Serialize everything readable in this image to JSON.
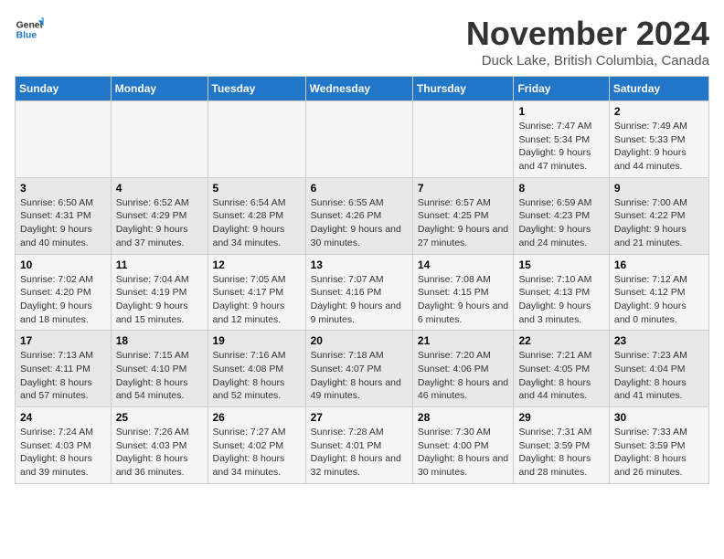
{
  "logo": {
    "line1": "General",
    "line2": "Blue"
  },
  "title": "November 2024",
  "subtitle": "Duck Lake, British Columbia, Canada",
  "days_of_week": [
    "Sunday",
    "Monday",
    "Tuesday",
    "Wednesday",
    "Thursday",
    "Friday",
    "Saturday"
  ],
  "weeks": [
    [
      {
        "day": "",
        "info": ""
      },
      {
        "day": "",
        "info": ""
      },
      {
        "day": "",
        "info": ""
      },
      {
        "day": "",
        "info": ""
      },
      {
        "day": "",
        "info": ""
      },
      {
        "day": "1",
        "info": "Sunrise: 7:47 AM\nSunset: 5:34 PM\nDaylight: 9 hours and 47 minutes."
      },
      {
        "day": "2",
        "info": "Sunrise: 7:49 AM\nSunset: 5:33 PM\nDaylight: 9 hours and 44 minutes."
      }
    ],
    [
      {
        "day": "3",
        "info": "Sunrise: 6:50 AM\nSunset: 4:31 PM\nDaylight: 9 hours and 40 minutes."
      },
      {
        "day": "4",
        "info": "Sunrise: 6:52 AM\nSunset: 4:29 PM\nDaylight: 9 hours and 37 minutes."
      },
      {
        "day": "5",
        "info": "Sunrise: 6:54 AM\nSunset: 4:28 PM\nDaylight: 9 hours and 34 minutes."
      },
      {
        "day": "6",
        "info": "Sunrise: 6:55 AM\nSunset: 4:26 PM\nDaylight: 9 hours and 30 minutes."
      },
      {
        "day": "7",
        "info": "Sunrise: 6:57 AM\nSunset: 4:25 PM\nDaylight: 9 hours and 27 minutes."
      },
      {
        "day": "8",
        "info": "Sunrise: 6:59 AM\nSunset: 4:23 PM\nDaylight: 9 hours and 24 minutes."
      },
      {
        "day": "9",
        "info": "Sunrise: 7:00 AM\nSunset: 4:22 PM\nDaylight: 9 hours and 21 minutes."
      }
    ],
    [
      {
        "day": "10",
        "info": "Sunrise: 7:02 AM\nSunset: 4:20 PM\nDaylight: 9 hours and 18 minutes."
      },
      {
        "day": "11",
        "info": "Sunrise: 7:04 AM\nSunset: 4:19 PM\nDaylight: 9 hours and 15 minutes."
      },
      {
        "day": "12",
        "info": "Sunrise: 7:05 AM\nSunset: 4:17 PM\nDaylight: 9 hours and 12 minutes."
      },
      {
        "day": "13",
        "info": "Sunrise: 7:07 AM\nSunset: 4:16 PM\nDaylight: 9 hours and 9 minutes."
      },
      {
        "day": "14",
        "info": "Sunrise: 7:08 AM\nSunset: 4:15 PM\nDaylight: 9 hours and 6 minutes."
      },
      {
        "day": "15",
        "info": "Sunrise: 7:10 AM\nSunset: 4:13 PM\nDaylight: 9 hours and 3 minutes."
      },
      {
        "day": "16",
        "info": "Sunrise: 7:12 AM\nSunset: 4:12 PM\nDaylight: 9 hours and 0 minutes."
      }
    ],
    [
      {
        "day": "17",
        "info": "Sunrise: 7:13 AM\nSunset: 4:11 PM\nDaylight: 8 hours and 57 minutes."
      },
      {
        "day": "18",
        "info": "Sunrise: 7:15 AM\nSunset: 4:10 PM\nDaylight: 8 hours and 54 minutes."
      },
      {
        "day": "19",
        "info": "Sunrise: 7:16 AM\nSunset: 4:08 PM\nDaylight: 8 hours and 52 minutes."
      },
      {
        "day": "20",
        "info": "Sunrise: 7:18 AM\nSunset: 4:07 PM\nDaylight: 8 hours and 49 minutes."
      },
      {
        "day": "21",
        "info": "Sunrise: 7:20 AM\nSunset: 4:06 PM\nDaylight: 8 hours and 46 minutes."
      },
      {
        "day": "22",
        "info": "Sunrise: 7:21 AM\nSunset: 4:05 PM\nDaylight: 8 hours and 44 minutes."
      },
      {
        "day": "23",
        "info": "Sunrise: 7:23 AM\nSunset: 4:04 PM\nDaylight: 8 hours and 41 minutes."
      }
    ],
    [
      {
        "day": "24",
        "info": "Sunrise: 7:24 AM\nSunset: 4:03 PM\nDaylight: 8 hours and 39 minutes."
      },
      {
        "day": "25",
        "info": "Sunrise: 7:26 AM\nSunset: 4:03 PM\nDaylight: 8 hours and 36 minutes."
      },
      {
        "day": "26",
        "info": "Sunrise: 7:27 AM\nSunset: 4:02 PM\nDaylight: 8 hours and 34 minutes."
      },
      {
        "day": "27",
        "info": "Sunrise: 7:28 AM\nSunset: 4:01 PM\nDaylight: 8 hours and 32 minutes."
      },
      {
        "day": "28",
        "info": "Sunrise: 7:30 AM\nSunset: 4:00 PM\nDaylight: 8 hours and 30 minutes."
      },
      {
        "day": "29",
        "info": "Sunrise: 7:31 AM\nSunset: 3:59 PM\nDaylight: 8 hours and 28 minutes."
      },
      {
        "day": "30",
        "info": "Sunrise: 7:33 AM\nSunset: 3:59 PM\nDaylight: 8 hours and 26 minutes."
      }
    ]
  ]
}
